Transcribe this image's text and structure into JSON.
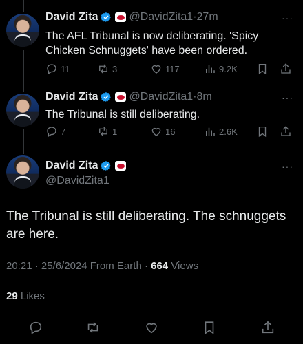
{
  "tweets": [
    {
      "name": "David Zita",
      "handle": "@DavidZita1",
      "sep": "·",
      "time": "27m",
      "text": "The AFL Tribunal is now deliberating. 'Spicy Chicken Schnuggets' have been ordered.",
      "replies": "11",
      "reposts": "3",
      "likes": "117",
      "views": "9.2K"
    },
    {
      "name": "David Zita",
      "handle": "@DavidZita1",
      "sep": "·",
      "time": "8m",
      "text": "The Tribunal is still deliberating.",
      "replies": "7",
      "reposts": "1",
      "likes": "16",
      "views": "2.6K"
    }
  ],
  "main": {
    "name": "David Zita",
    "handle": "@DavidZita1",
    "text": "The Tribunal is still deliberating. The schnuggets are here.",
    "timestamp": "20:21 · 25/6/2024 From Earth ·",
    "views_count": "664",
    "views_label": "Views",
    "likes_count": "29",
    "likes_label": "Likes"
  },
  "more_glyph": "···",
  "colors": {
    "verified": "#1d9bf0",
    "muted": "#71767b",
    "text": "#e7e9ea",
    "affiliate": "#c8102e"
  }
}
